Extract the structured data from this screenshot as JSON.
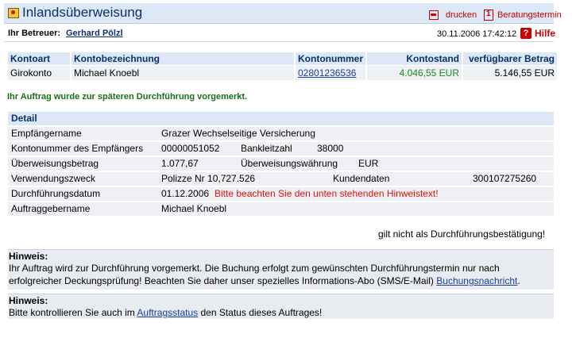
{
  "header": {
    "title": "Inlandsüberweisung",
    "print_label": "drucken",
    "consult_label": "Beratungstermin",
    "advisor_label": "Ihr Betreuer:",
    "advisor_name": "Gerhard Pölzl",
    "datetime": "30.11.2006 17:42:12",
    "help_label": "Hilfe"
  },
  "account": {
    "headers": [
      "Kontoart",
      "Kontobezeichnung",
      "Kontonummer",
      "Kontostand",
      "verfügbarer Betrag"
    ],
    "row": {
      "type": "Girokonto",
      "name": "Michael Knoebl",
      "number": "02801236536",
      "balance": "4.046,55 EUR",
      "available": "5.146,55 EUR"
    }
  },
  "status_message": "Ihr Auftrag wurde zur späteren Durchführung vorgemerkt.",
  "detail": {
    "heading": "Detail",
    "recipient_label": "Empfängername",
    "recipient": "Grazer Wechselseitige Versicherung",
    "recipient_account_label": "Kontonummer des Empfängers",
    "recipient_account": "00000051052",
    "bank_code_label": "Bankleitzahl",
    "bank_code": "38000",
    "amount_label": "Überweisungsbetrag",
    "amount": "1.077,67",
    "currency_label": "Überweisungswährung",
    "currency": "EUR",
    "purpose_label": "Verwendungszweck",
    "purpose": "Polizze Nr 10,727.526",
    "customer_data_label": "Kundendaten",
    "customer_data": "300107275260",
    "execution_date_label": "Durchführungsdatum",
    "execution_date": "01.12.2006",
    "execution_warning": "Bitte beachten Sie den unten stehenden Hinweistext!",
    "orderer_label": "Auftraggebername",
    "orderer": "Michael Knoebl"
  },
  "note": "gilt nicht als Durchführungsbestätigung!",
  "hint1": {
    "title": "Hinweis:",
    "line1": "Ihr Auftrag wird zur Durchführung vorgemerkt. Die Buchung erfolgt zum gewünschten Durchführungstermin nur nach",
    "line2": "erfolgreicher Deckungsprüfung! Beachten Sie daher unser spezielles Informations-Abo (SMS/E-Mail)",
    "link": "Buchungsnachricht",
    "after_link": "."
  },
  "hint2": {
    "title": "Hinweis:",
    "before_link": "Bitte kontrollieren Sie auch im",
    "link": "Auftragsstatus",
    "after_link": "den Status dieses Auftrages!"
  }
}
